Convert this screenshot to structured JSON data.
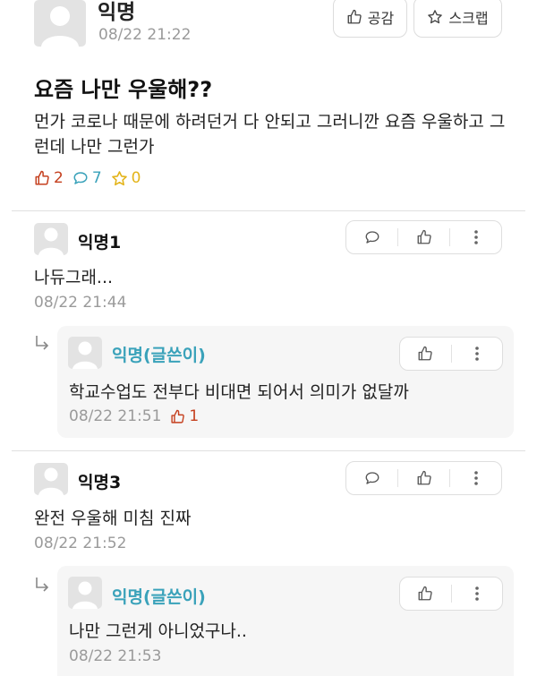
{
  "post": {
    "author": "익명",
    "time": "08/22 21:22",
    "title": "요즘 나만 우울해??",
    "body": "먼가 코로나 때문에 하려던거 다 안되고 그러니깐 요즘 우울하고 그런데 나만 그런가",
    "likes": "2",
    "comments": "7",
    "scraps": "0",
    "buttons": {
      "like": "공감",
      "scrap": "스크랩"
    }
  },
  "comments": [
    {
      "author": "익명1",
      "text": "나듀그래...",
      "time": "08/22 21:44",
      "reply": {
        "author": "익명(글쓴이)",
        "text": "학교수업도 전부다 비대면 되어서 의미가 없달까",
        "time": "08/22 21:51",
        "likes": "1"
      }
    },
    {
      "author": "익명3",
      "text": "완전 우울해 미침 진짜",
      "time": "08/22 21:52",
      "reply": {
        "author": "익명(글쓴이)",
        "text": "나만 그런게 아니었구나..",
        "time": "08/22 21:53"
      }
    }
  ],
  "icons": {
    "like": "thumbs-up-icon",
    "comment": "speech-bubble-icon",
    "scrap": "star-icon",
    "more": "more-vertical-icon",
    "reply": "reply-arrow-icon",
    "avatar": "default-user-icon"
  },
  "colors": {
    "like": "#c5401f",
    "comment": "#3aa2ba",
    "scrap": "#e3b41a",
    "reply_author": "#3aa2ba",
    "muted": "#9a9a9a",
    "reply_bg": "#f6f6f6"
  }
}
